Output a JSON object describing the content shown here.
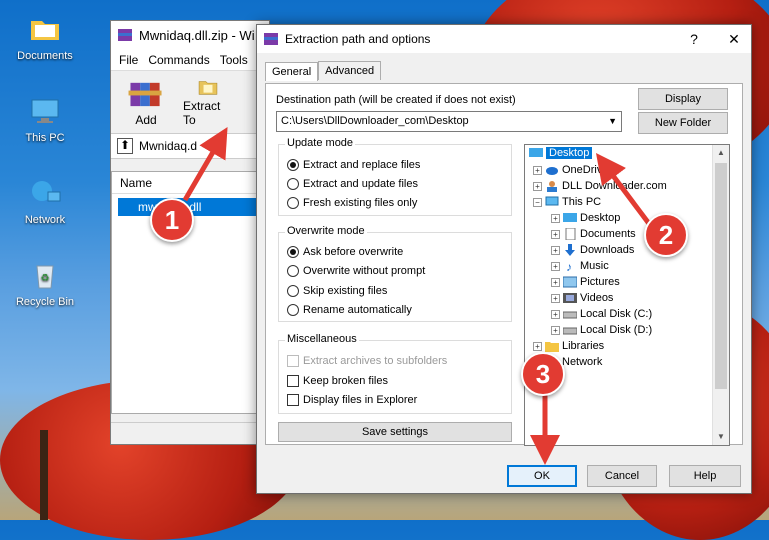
{
  "desktop": {
    "icons": [
      {
        "label": "Documents"
      },
      {
        "label": "This PC"
      },
      {
        "label": "Network"
      },
      {
        "label": "Recycle Bin"
      }
    ]
  },
  "winrar": {
    "title": "Mwnidaq.dll.zip - Wi",
    "menu": [
      "File",
      "Commands",
      "Tools"
    ],
    "toolbar": {
      "add": "Add",
      "extract_to": "Extract To"
    },
    "path": "Mwnidaq.d",
    "column_name": "Name",
    "file": "mwnidaq.dll"
  },
  "dialog": {
    "title": "Extraction path and options",
    "help_symbol": "?",
    "close_symbol": "✕",
    "tabs": [
      "General",
      "Advanced"
    ],
    "dest_label": "Destination path (will be created if does not exist)",
    "dest_value": "C:\\Users\\DllDownloader_com\\Desktop",
    "display_btn": "Display",
    "new_folder_btn": "New Folder",
    "update_mode": {
      "title": "Update mode",
      "options": [
        "Extract and replace files",
        "Extract and update files",
        "Fresh existing files only"
      ],
      "selected": 0
    },
    "overwrite_mode": {
      "title": "Overwrite mode",
      "options": [
        "Ask before overwrite",
        "Overwrite without prompt",
        "Skip existing files",
        "Rename automatically"
      ],
      "selected": 0
    },
    "misc": {
      "title": "Miscellaneous",
      "options": [
        "Extract archives to subfolders",
        "Keep broken files",
        "Display files in Explorer"
      ]
    },
    "save_settings": "Save settings",
    "tree": [
      {
        "label": "Desktop"
      },
      {
        "label": "OneDrive"
      },
      {
        "label": "DLL Downloader.com"
      },
      {
        "label": "This PC"
      },
      {
        "label": "Desktop"
      },
      {
        "label": "Documents"
      },
      {
        "label": "Downloads"
      },
      {
        "label": "Music"
      },
      {
        "label": "Pictures"
      },
      {
        "label": "Videos"
      },
      {
        "label": "Local Disk (C:)"
      },
      {
        "label": "Local Disk (D:)"
      },
      {
        "label": "Libraries"
      },
      {
        "label": "Network"
      }
    ],
    "ok": "OK",
    "cancel": "Cancel",
    "help": "Help"
  },
  "annotations": [
    {
      "number": "1"
    },
    {
      "number": "2"
    },
    {
      "number": "3"
    }
  ],
  "colors": {
    "badge": "#e23b32",
    "selection": "#0078d7"
  }
}
